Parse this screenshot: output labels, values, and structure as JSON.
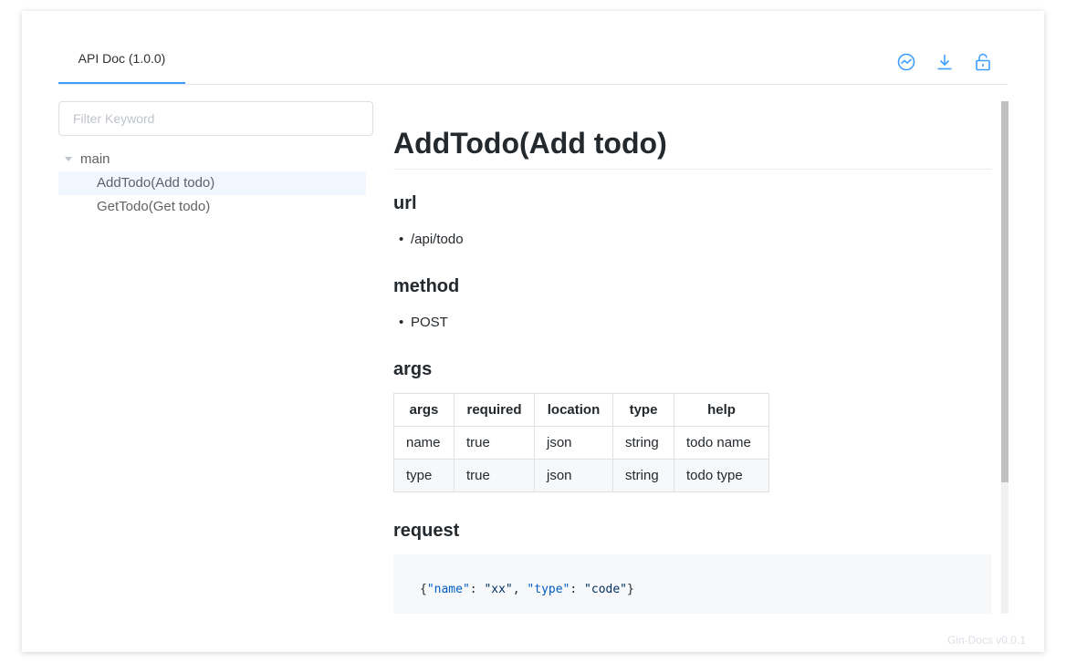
{
  "tabs": [
    {
      "label": "API Doc (1.0.0)"
    }
  ],
  "toolbar": {
    "icons": [
      "chart-icon",
      "download-icon",
      "unlock-icon"
    ],
    "accent": "#409eff"
  },
  "sidebar": {
    "filter_placeholder": "Filter Keyword",
    "tree": {
      "root": "main",
      "children": [
        "AddTodo(Add todo)",
        "GetTodo(Get todo)"
      ],
      "selected": "AddTodo(Add todo)"
    }
  },
  "doc": {
    "title": "AddTodo(Add todo)",
    "url_heading": "url",
    "url_value": "/api/todo",
    "method_heading": "method",
    "method_value": "POST",
    "args_heading": "args",
    "args_table": {
      "headers": [
        "args",
        "required",
        "location",
        "type",
        "help"
      ],
      "rows": [
        [
          "name",
          "true",
          "json",
          "string",
          "todo name"
        ],
        [
          "type",
          "true",
          "json",
          "string",
          "todo type"
        ]
      ]
    },
    "request_heading": "request",
    "request_code": {
      "open": "{",
      "k1": "\"name\"",
      "sep1": ": ",
      "v1": "\"xx\"",
      "comma": ", ",
      "k2": "\"type\"",
      "sep2": ": ",
      "v2": "\"code\"",
      "close": "}"
    }
  },
  "footer": "Gin-Docs v0.0.1"
}
